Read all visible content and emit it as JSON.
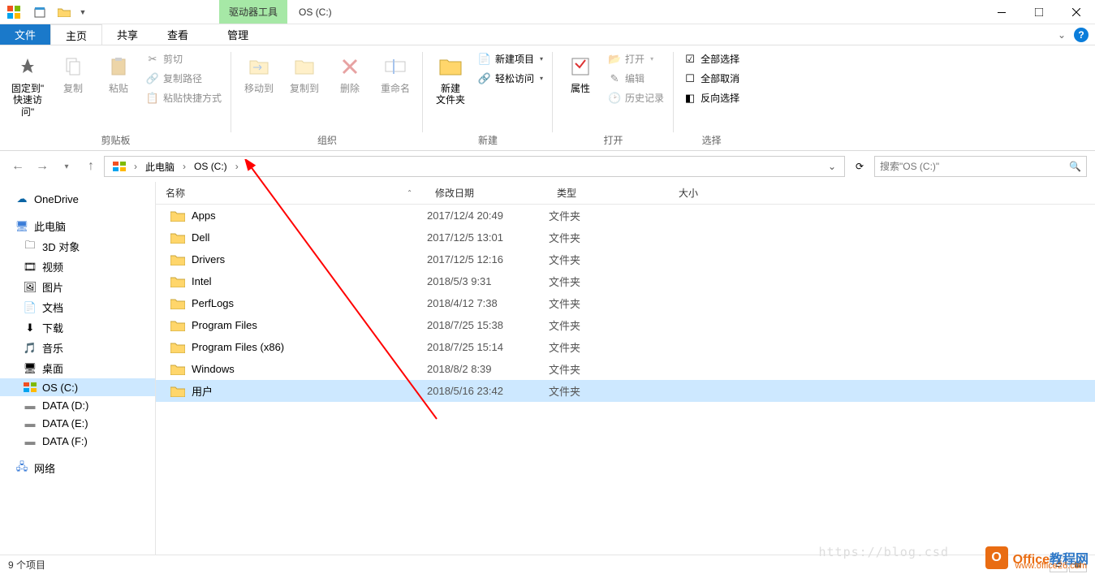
{
  "titlebar": {
    "context_tab": "驱动器工具",
    "window_title": "OS (C:)"
  },
  "tabs": {
    "file": "文件",
    "home": "主页",
    "share": "共享",
    "view": "查看",
    "manage": "管理"
  },
  "ribbon": {
    "clipboard": {
      "label": "剪贴板",
      "pin": "固定到\"\n快速访问\"",
      "copy": "复制",
      "paste": "粘贴",
      "cut": "剪切",
      "copy_path": "复制路径",
      "paste_shortcut": "粘贴快捷方式"
    },
    "organize": {
      "label": "组织",
      "move_to": "移动到",
      "copy_to": "复制到",
      "delete": "删除",
      "rename": "重命名"
    },
    "new": {
      "label": "新建",
      "new_folder": "新建\n文件夹",
      "new_item": "新建项目",
      "easy_access": "轻松访问"
    },
    "open": {
      "label": "打开",
      "properties": "属性",
      "open": "打开",
      "edit": "编辑",
      "history": "历史记录"
    },
    "select": {
      "label": "选择",
      "select_all": "全部选择",
      "select_none": "全部取消",
      "invert": "反向选择"
    }
  },
  "breadcrumb": {
    "this_pc": "此电脑",
    "drive": "OS (C:)"
  },
  "search": {
    "placeholder": "搜索\"OS (C:)\""
  },
  "tree": {
    "onedrive": "OneDrive",
    "this_pc": "此电脑",
    "objects3d": "3D 对象",
    "videos": "视频",
    "pictures": "图片",
    "documents": "文档",
    "downloads": "下载",
    "music": "音乐",
    "desktop": "桌面",
    "os_c": "OS (C:)",
    "data_d": "DATA (D:)",
    "data_e": "DATA (E:)",
    "data_f": "DATA (F:)",
    "network": "网络"
  },
  "columns": {
    "name": "名称",
    "date": "修改日期",
    "type": "类型",
    "size": "大小"
  },
  "rows": [
    {
      "name": "Apps",
      "date": "2017/12/4 20:49",
      "type": "文件夹"
    },
    {
      "name": "Dell",
      "date": "2017/12/5 13:01",
      "type": "文件夹"
    },
    {
      "name": "Drivers",
      "date": "2017/12/5 12:16",
      "type": "文件夹"
    },
    {
      "name": "Intel",
      "date": "2018/5/3 9:31",
      "type": "文件夹"
    },
    {
      "name": "PerfLogs",
      "date": "2018/4/12 7:38",
      "type": "文件夹"
    },
    {
      "name": "Program Files",
      "date": "2018/7/25 15:38",
      "type": "文件夹"
    },
    {
      "name": "Program Files (x86)",
      "date": "2018/7/25 15:14",
      "type": "文件夹"
    },
    {
      "name": "Windows",
      "date": "2018/8/2 8:39",
      "type": "文件夹"
    },
    {
      "name": "用户",
      "date": "2018/5/16 23:42",
      "type": "文件夹",
      "selected": true
    }
  ],
  "status": {
    "count": "9 个项目"
  },
  "watermark": {
    "brand1": "Office",
    "brand2": "教程网",
    "url": "www.office26.com",
    "ghost": "https://blog.csd"
  }
}
